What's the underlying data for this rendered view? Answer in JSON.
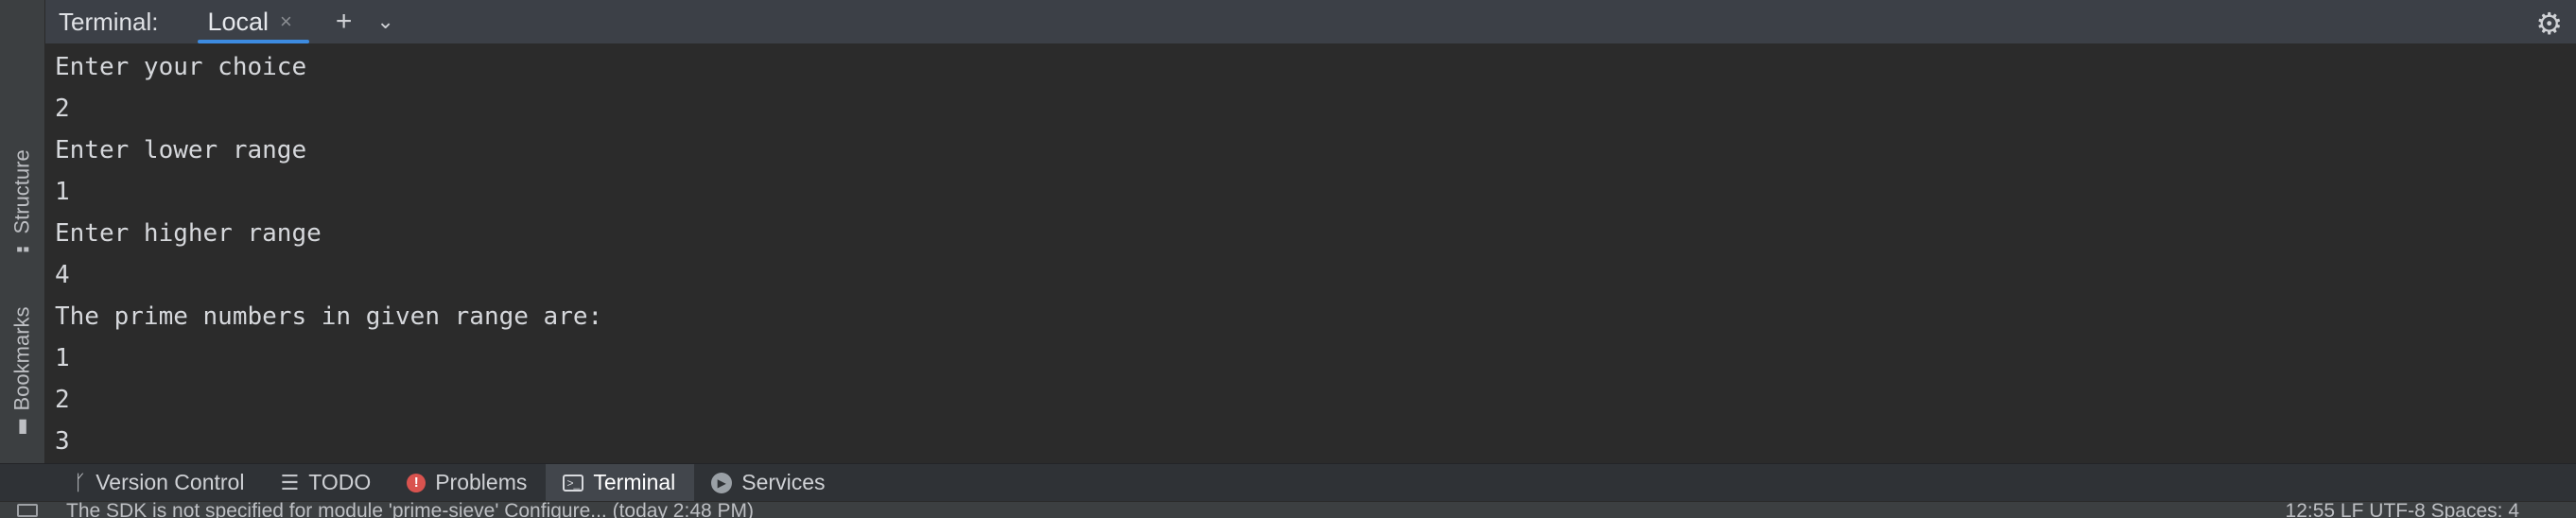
{
  "side_tabs": {
    "structure": {
      "label": "Structure",
      "icon": "structure-icon"
    },
    "bookmarks": {
      "label": "Bookmarks",
      "icon": "bookmark-icon"
    }
  },
  "header": {
    "title": "Terminal:",
    "tab_label": "Local",
    "close_glyph": "×",
    "add_glyph": "+",
    "dropdown_glyph": "⌄",
    "settings_glyph": "⚙"
  },
  "terminal": {
    "lines": [
      "Enter your choice",
      "2",
      "Enter lower range",
      "1",
      "Enter higher range",
      "4",
      "The prime numbers in given range are:",
      "1",
      "2",
      "3"
    ]
  },
  "bottom_tools": [
    {
      "label": "Version Control",
      "icon": "branch-icon",
      "active": false
    },
    {
      "label": "TODO",
      "icon": "list-icon",
      "active": false
    },
    {
      "label": "Problems",
      "icon": "error-icon",
      "active": false
    },
    {
      "label": "Terminal",
      "icon": "terminal-icon",
      "active": true
    },
    {
      "label": "Services",
      "icon": "services-icon",
      "active": false
    }
  ],
  "status": {
    "message": "The SDK is not specified for module 'prime-sieve' Configure... (today 2:48 PM)",
    "right": "12:55   LF   UTF-8   Spaces: 4"
  },
  "colors": {
    "accent": "#3d8be0",
    "terminal_bg": "#2b2b2b",
    "error": "#d9534f"
  }
}
